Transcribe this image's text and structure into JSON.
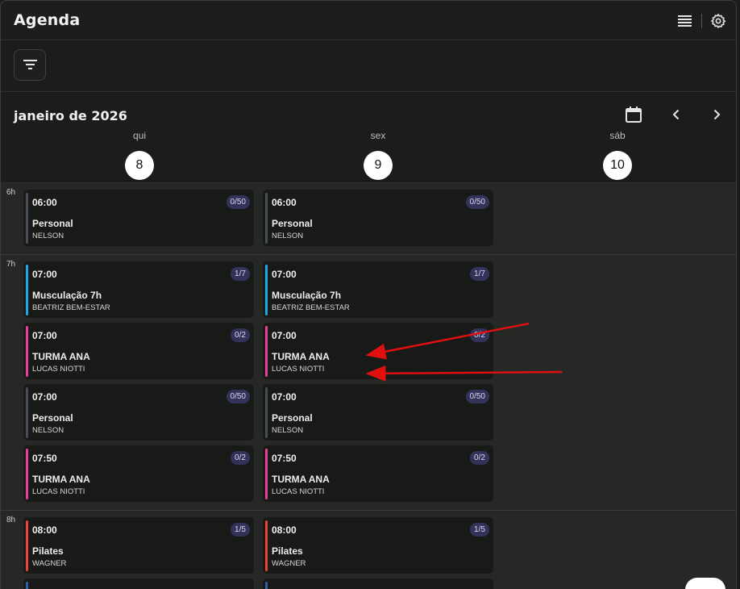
{
  "app": {
    "title": "Agenda"
  },
  "toolbar": {
    "list_icon": "list-view-icon",
    "settings_icon": "gear-icon",
    "filter_icon": "filter-icon"
  },
  "calendar": {
    "month_title": "janeiro de 2026",
    "days": [
      {
        "name": "qui",
        "num": "8"
      },
      {
        "name": "sex",
        "num": "9"
      },
      {
        "name": "sáb",
        "num": "10"
      }
    ],
    "hours": [
      "6h",
      "7h",
      "8h"
    ]
  },
  "colors": {
    "pink": "#e8409a",
    "blue": "#1ea7e6",
    "gray": "#4a4d55",
    "red": "#e8443a",
    "navy": "#2f5ea8",
    "arrow": "#e01010"
  },
  "events": {
    "qui": [
      {
        "time": "06:00",
        "name": "Personal",
        "coach": "NELSON",
        "count": "0/50",
        "color": "gray"
      },
      {
        "time": "07:00",
        "name": "Musculação 7h",
        "coach": "BEATRIZ BEM-ESTAR",
        "count": "1/7",
        "color": "blue"
      },
      {
        "time": "07:00",
        "name": "TURMA ANA",
        "coach": "LUCAS NIOTTI",
        "count": "0/2",
        "color": "pink"
      },
      {
        "time": "07:00",
        "name": "Personal",
        "coach": "NELSON",
        "count": "0/50",
        "color": "gray"
      },
      {
        "time": "07:50",
        "name": "TURMA ANA",
        "coach": "LUCAS NIOTTI",
        "count": "0/2",
        "color": "pink"
      },
      {
        "time": "08:00",
        "name": "Pilates",
        "coach": "WAGNER",
        "count": "1/5",
        "color": "red"
      }
    ],
    "sex": [
      {
        "time": "06:00",
        "name": "Personal",
        "coach": "NELSON",
        "count": "0/50",
        "color": "gray"
      },
      {
        "time": "07:00",
        "name": "Musculação 7h",
        "coach": "BEATRIZ BEM-ESTAR",
        "count": "1/7",
        "color": "blue"
      },
      {
        "time": "07:00",
        "name": "TURMA ANA",
        "coach": "LUCAS NIOTTI",
        "count": "0/2",
        "color": "pink"
      },
      {
        "time": "07:00",
        "name": "Personal",
        "coach": "NELSON",
        "count": "0/50",
        "color": "gray"
      },
      {
        "time": "07:50",
        "name": "TURMA ANA",
        "coach": "LUCAS NIOTTI",
        "count": "0/2",
        "color": "pink"
      },
      {
        "time": "08:00",
        "name": "Pilates",
        "coach": "WAGNER",
        "count": "1/5",
        "color": "red"
      }
    ]
  }
}
